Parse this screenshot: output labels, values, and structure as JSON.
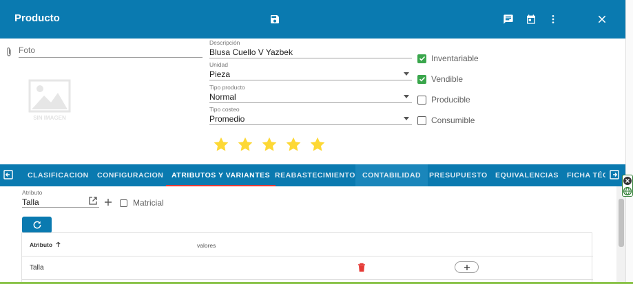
{
  "header": {
    "title": "Producto",
    "icons": [
      "save-icon",
      "comment-icon",
      "calendar-icon",
      "more-vert-icon",
      "close-icon"
    ]
  },
  "form": {
    "foto_label": "Foto",
    "no_image_text": "SIN IMAGEN",
    "descripcion": {
      "label": "Descripción",
      "value": "Blusa Cuello V Yazbek"
    },
    "unidad": {
      "label": "Unidad",
      "value": "Pieza"
    },
    "tipo_producto": {
      "label": "Tipo producto",
      "value": "Normal"
    },
    "tipo_costeo": {
      "label": "Tipo costeo",
      "value": "Promedio"
    },
    "checks": [
      {
        "label": "Inventariable",
        "checked": true
      },
      {
        "label": "Vendible",
        "checked": true
      },
      {
        "label": "Producible",
        "checked": false
      },
      {
        "label": "Consumible",
        "checked": false
      }
    ],
    "rating": 5,
    "star_color": "#fdd835"
  },
  "tabs": [
    {
      "label": "CLASIFICACION"
    },
    {
      "label": "CONFIGURACION"
    },
    {
      "label": "ATRIBUTOS Y VARIANTES",
      "active": true
    },
    {
      "label": "REABASTECIMIENTO"
    },
    {
      "label": "CONTABILIDAD"
    },
    {
      "label": "PRESUPUESTO"
    },
    {
      "label": "EQUIVALENCIAS"
    },
    {
      "label": "FICHA TÉC"
    }
  ],
  "atributos": {
    "label": "Atributo",
    "value": "Talla",
    "matricial_label": "Matricial",
    "table": {
      "columns": [
        "Atributo",
        "valores"
      ],
      "rows": [
        {
          "atributo": "Talla"
        }
      ]
    }
  },
  "colors": {
    "primary": "#0a7ab0",
    "active_tab_underline": "#e53935",
    "check_green": "#3aa64c",
    "delete_red": "#e53935"
  }
}
